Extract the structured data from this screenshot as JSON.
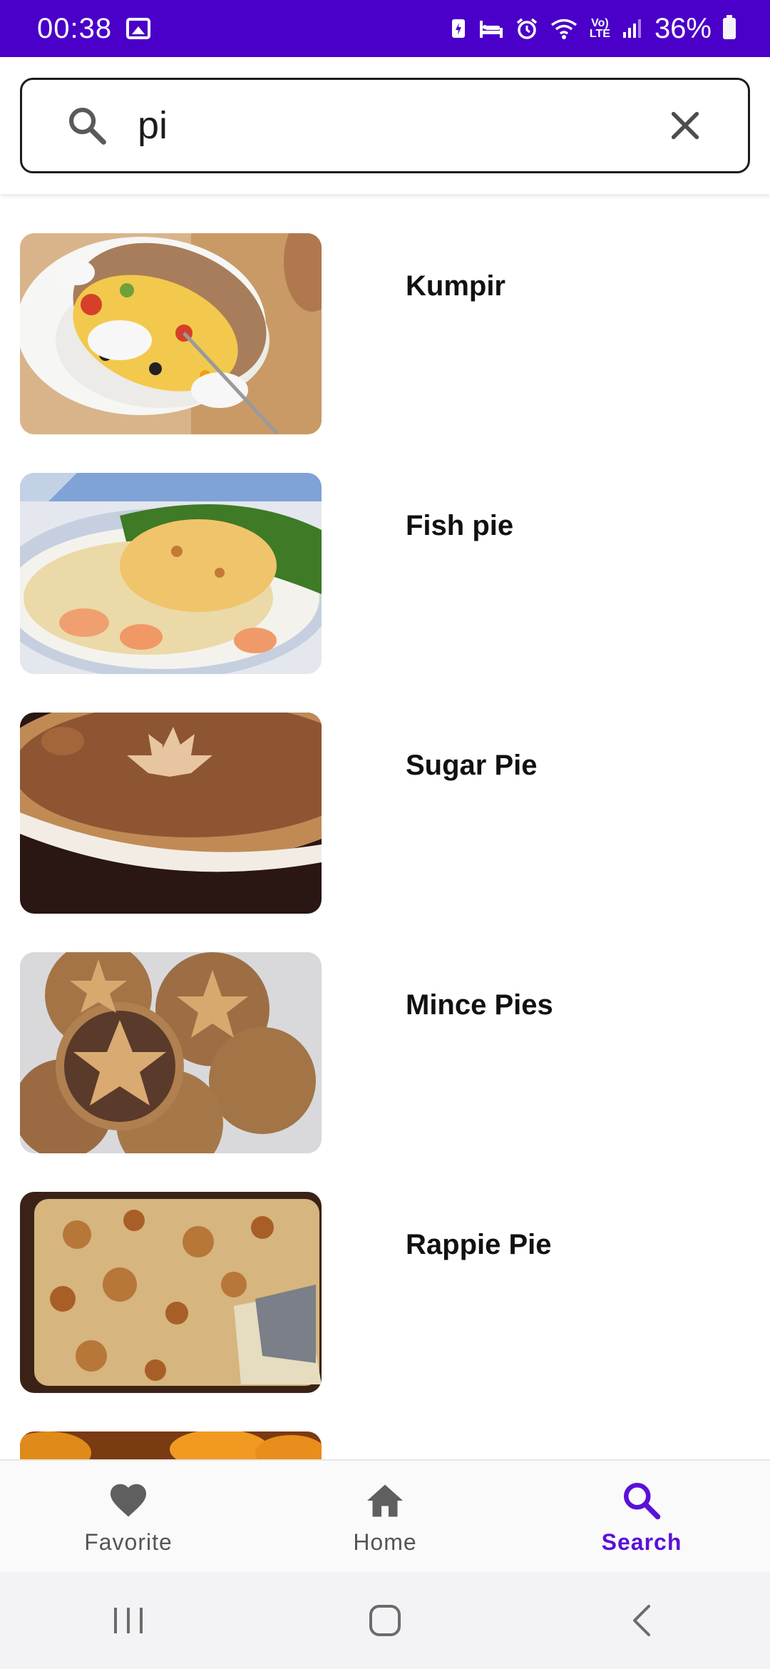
{
  "status_bar": {
    "time": "00:38",
    "battery_percent": "36%",
    "icons": [
      "gallery-icon",
      "battery-saver-icon",
      "sleep-icon",
      "alarm-icon",
      "wifi-icon",
      "volte-icon",
      "signal-icon",
      "battery-icon"
    ],
    "background": "#4a00c8"
  },
  "search": {
    "query": "pi"
  },
  "results": [
    {
      "title": "Kumpir",
      "image": "baked-potato-dish"
    },
    {
      "title": "Fish pie",
      "image": "fish-pie-dish"
    },
    {
      "title": "Sugar Pie",
      "image": "sugar-pie-dish"
    },
    {
      "title": "Mince Pies",
      "image": "mince-pies-dish"
    },
    {
      "title": "Rappie Pie",
      "image": "rappie-pie-dish"
    }
  ],
  "bottom_nav": {
    "items": [
      {
        "label": "Favorite",
        "icon": "heart-icon"
      },
      {
        "label": "Home",
        "icon": "home-icon"
      },
      {
        "label": "Search",
        "icon": "search-icon",
        "active": true
      }
    ],
    "accent": "#5b10d8"
  },
  "system_nav": {
    "buttons": [
      "recents-icon",
      "home-circle-icon",
      "back-icon"
    ]
  }
}
